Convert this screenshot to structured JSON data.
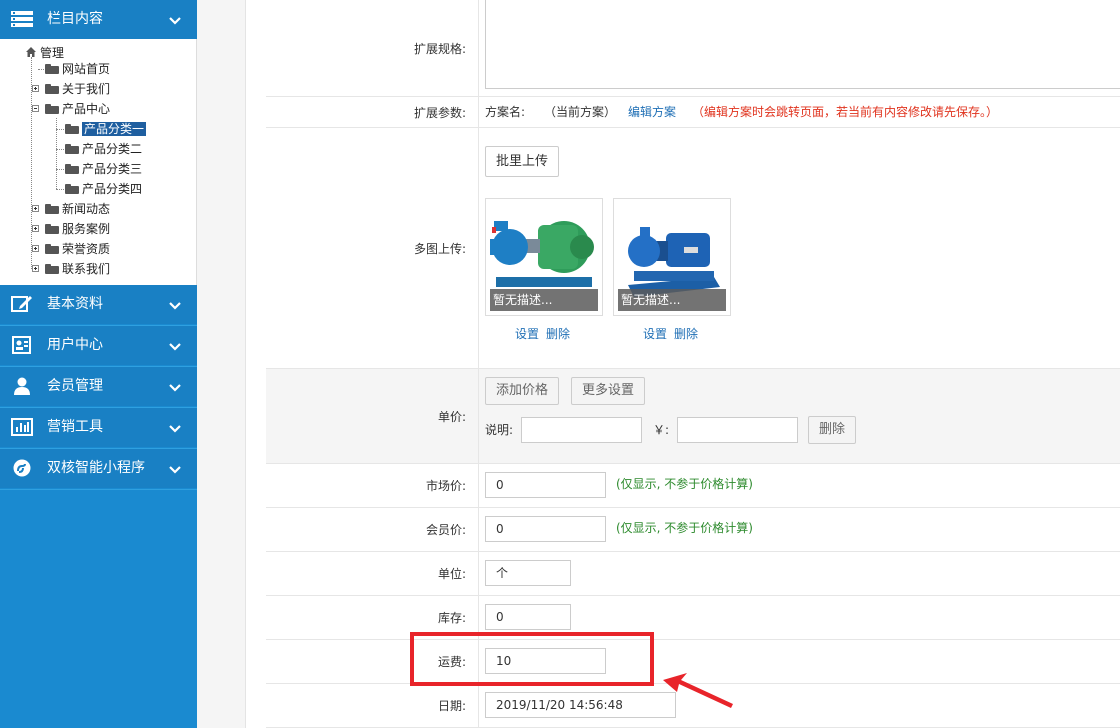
{
  "sidebar": {
    "sections": [
      {
        "label": "栏目内容",
        "icon": "list-icon"
      },
      {
        "label": "基本资料",
        "icon": "edit-icon"
      },
      {
        "label": "用户中心",
        "icon": "profile-card-icon"
      },
      {
        "label": "会员管理",
        "icon": "user-icon"
      },
      {
        "label": "营销工具",
        "icon": "bar-chart-icon"
      },
      {
        "label": "双核智能小程序",
        "icon": "miniprogram-icon"
      }
    ],
    "tree": {
      "root": "管理",
      "items": [
        "网站首页",
        "关于我们",
        "产品中心",
        "产品分类一",
        "产品分类二",
        "产品分类三",
        "产品分类四",
        "新闻动态",
        "服务案例",
        "荣誉资质",
        "联系我们"
      ],
      "selected": "产品分类一"
    }
  },
  "form": {
    "ext_spec": {
      "label": "扩展规格:"
    },
    "ext_params": {
      "label": "扩展参数:",
      "scheme_label": "方案名:",
      "scheme_value": "（当前方案）",
      "edit_link": "编辑方案",
      "warning": "（编辑方案时会跳转页面，若当前有内容修改请先保存。）"
    },
    "multi_upload": {
      "label": "多图上传:",
      "batch_button": "批里上传",
      "images": [
        {
          "caption": "暂无描述...",
          "set": "设置",
          "delete": "删除"
        },
        {
          "caption": "暂无描述...",
          "set": "设置",
          "delete": "删除"
        }
      ]
    },
    "unit_price": {
      "label": "单价:",
      "add_price_button": "添加价格",
      "more_settings_button": "更多设置",
      "desc_label": "说明:",
      "currency_label": "￥:",
      "delete_button": "删除"
    },
    "market_price": {
      "label": "市场价:",
      "value": "0",
      "hint": "(仅显示, 不参于价格计算)"
    },
    "member_price": {
      "label": "会员价:",
      "value": "0",
      "hint": "(仅显示, 不参于价格计算)"
    },
    "unit": {
      "label": "单位:",
      "value": "个"
    },
    "stock": {
      "label": "库存:",
      "value": "0"
    },
    "shipping": {
      "label": "运费:",
      "value": "10"
    },
    "date": {
      "label": "日期:",
      "value": "2019/11/20 14:56:48"
    }
  },
  "colors": {
    "sidebar": "#1a8ad0",
    "highlight": "#e8242a",
    "hint": "#2e8b2e",
    "link": "#1f6fb5",
    "warning": "#e0331e"
  }
}
